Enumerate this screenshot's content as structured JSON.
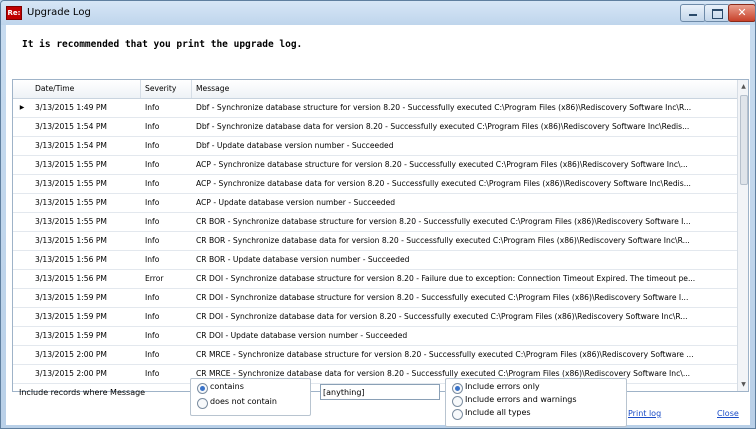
{
  "window": {
    "icon_text": "Re:",
    "title": "Upgrade Log"
  },
  "banner": "It is recommended that you print the upgrade log.",
  "grid": {
    "headers": [
      "Date/Time",
      "Severity",
      "Message"
    ],
    "rows": [
      {
        "datetime": "3/13/2015 1:49 PM",
        "severity": "Info",
        "message": "Dbf - Synchronize database structure for version 8.20 - Successfully executed C:\\Program Files (x86)\\Rediscovery Software Inc\\R..."
      },
      {
        "datetime": "3/13/2015 1:54 PM",
        "severity": "Info",
        "message": "Dbf - Synchronize database data for version 8.20 - Successfully executed C:\\Program Files (x86)\\Rediscovery Software Inc\\Redis..."
      },
      {
        "datetime": "3/13/2015 1:54 PM",
        "severity": "Info",
        "message": "Dbf - Update database version number - Succeeded"
      },
      {
        "datetime": "3/13/2015 1:55 PM",
        "severity": "Info",
        "message": "ACP - Synchronize database structure for version 8.20 - Successfully executed C:\\Program Files (x86)\\Rediscovery Software Inc\\..."
      },
      {
        "datetime": "3/13/2015 1:55 PM",
        "severity": "Info",
        "message": "ACP - Synchronize database data for version 8.20 - Successfully executed C:\\Program Files (x86)\\Rediscovery Software Inc\\Redis..."
      },
      {
        "datetime": "3/13/2015 1:55 PM",
        "severity": "Info",
        "message": "ACP - Update database version number - Succeeded"
      },
      {
        "datetime": "3/13/2015 1:55 PM",
        "severity": "Info",
        "message": "CR BOR - Synchronize database structure for version 8.20 - Successfully executed C:\\Program Files (x86)\\Rediscovery Software I..."
      },
      {
        "datetime": "3/13/2015 1:56 PM",
        "severity": "Info",
        "message": "CR BOR - Synchronize database data for version 8.20 - Successfully executed C:\\Program Files (x86)\\Rediscovery Software Inc\\R..."
      },
      {
        "datetime": "3/13/2015 1:56 PM",
        "severity": "Info",
        "message": "CR BOR - Update database version number - Succeeded"
      },
      {
        "datetime": "3/13/2015 1:56 PM",
        "severity": "Error",
        "message": "CR DOI - Synchronize database structure for version 8.20 - Failure due to exception: Connection Timeout Expired.  The timeout pe..."
      },
      {
        "datetime": "3/13/2015 1:59 PM",
        "severity": "Info",
        "message": "CR DOI - Synchronize database structure for version 8.20 - Successfully executed C:\\Program Files (x86)\\Rediscovery Software I..."
      },
      {
        "datetime": "3/13/2015 1:59 PM",
        "severity": "Info",
        "message": "CR DOI - Synchronize database data for version 8.20 - Successfully executed C:\\Program Files (x86)\\Rediscovery Software Inc\\R..."
      },
      {
        "datetime": "3/13/2015 1:59 PM",
        "severity": "Info",
        "message": "CR DOI - Update database version number - Succeeded"
      },
      {
        "datetime": "3/13/2015 2:00 PM",
        "severity": "Info",
        "message": "CR MRCE - Synchronize database structure for version 8.20 - Successfully executed C:\\Program Files (x86)\\Rediscovery Software ..."
      },
      {
        "datetime": "3/13/2015 2:00 PM",
        "severity": "Info",
        "message": "CR MRCE - Synchronize database data for version 8.20 - Successfully executed C:\\Program Files (x86)\\Rediscovery Software Inc\\..."
      }
    ],
    "selected_row_marker": "▶"
  },
  "filter": {
    "label": "Include records where Message",
    "match_options": [
      {
        "label": "contains",
        "selected": true
      },
      {
        "label": "does not contain",
        "selected": false
      }
    ],
    "text_value": "[anything]",
    "type_options": [
      {
        "label": "Include errors only",
        "selected": true
      },
      {
        "label": "Include errors and warnings",
        "selected": false
      },
      {
        "label": "Include all types",
        "selected": false
      }
    ]
  },
  "links": {
    "print": "Print log",
    "close": "Close"
  },
  "icons": {
    "app": "rediscovery-logo-icon",
    "minimize": "minimize-icon",
    "maximize": "maximize-icon",
    "close": "close-icon"
  }
}
